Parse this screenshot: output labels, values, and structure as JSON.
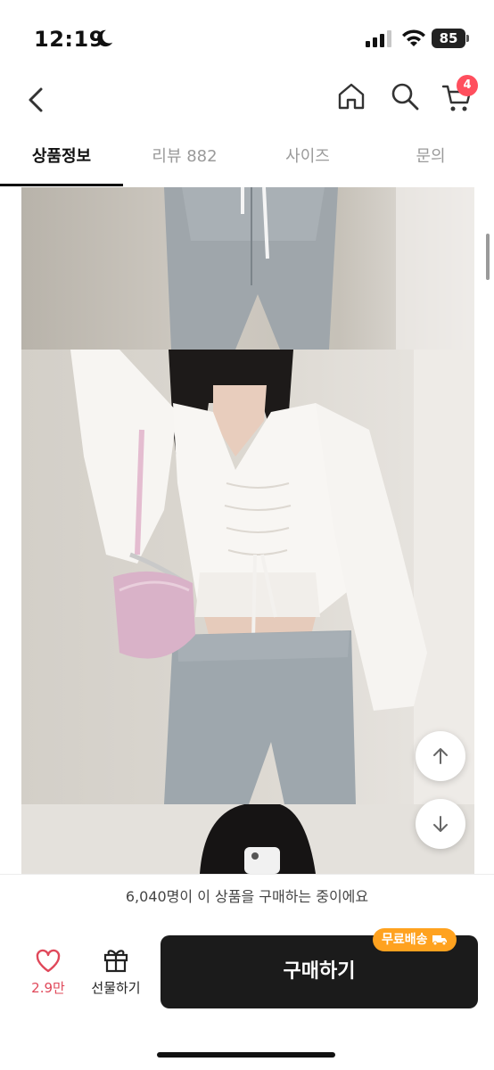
{
  "status": {
    "time": "12:19",
    "battery": "85"
  },
  "nav": {
    "cart_count": "4"
  },
  "tabs": [
    {
      "label": "상품정보"
    },
    {
      "label": "리뷰 882"
    },
    {
      "label": "사이즈"
    },
    {
      "label": "문의"
    }
  ],
  "notice": {
    "text": "6,040명이 이 상품을 구매하는 중이에요"
  },
  "bottom": {
    "like_count": "2.9만",
    "gift_label": "선물하기",
    "buy_label": "구매하기",
    "free_shipping_label": "무료배송"
  },
  "colors": {
    "accent": "#ff4f5e",
    "like": "#e0485a",
    "shipping_badge": "#ffa21f",
    "buy_button": "#1b1b1b"
  }
}
